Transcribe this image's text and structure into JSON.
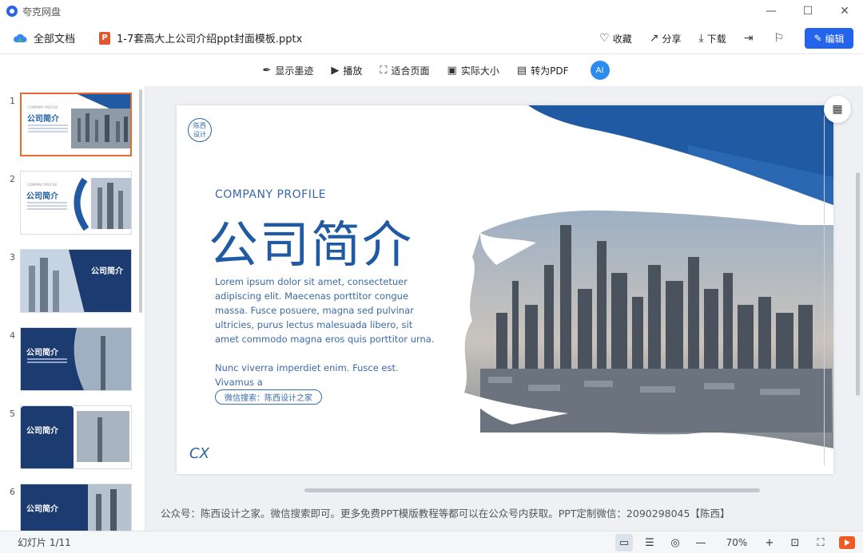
{
  "titlebar": {
    "app_name": "夸克网盘",
    "minimize": "—",
    "maximize": "☐",
    "close": "✕"
  },
  "docbar": {
    "all_docs": "全部文档",
    "file_icon": "P",
    "filename": "1-7套高大上公司介绍ppt封面模板.pptx",
    "favorite": "收藏",
    "share": "分享",
    "download": "下载",
    "edit": "编辑"
  },
  "toolbar": {
    "show_ink": "显示墨迹",
    "play": "播放",
    "fit_page": "适合页面",
    "actual_size": "实际大小",
    "to_pdf": "转为PDF",
    "ai": "AI"
  },
  "thumbnails": [
    {
      "num": "1",
      "sub": "COMPANY PROFILE",
      "title": "公司简介"
    },
    {
      "num": "2",
      "sub": "COMPANY PROFILE",
      "title": "公司简介"
    },
    {
      "num": "3",
      "sub": "COMPANY PROFILE",
      "title": "公司简介"
    },
    {
      "num": "4",
      "sub": "COMPANY PROFILE",
      "title": "公司简介"
    },
    {
      "num": "5",
      "sub": "COMPANY PROFILE",
      "title": "公司简介"
    },
    {
      "num": "6",
      "sub": "COMPANY PROFILE",
      "title": "公司简介"
    }
  ],
  "slide": {
    "logo_line1": "陈西",
    "logo_line2": "设计",
    "subtitle": "COMPANY PROFILE",
    "title": "公司简介",
    "body": "Lorem ipsum dolor sit amet, consectetuer adipiscing elit. Maecenas porttitor congue massa. Fusce posuere, magna sed pulvinar ultricies, purus lectus malesuada libero, sit amet commodo magna eros quis porttitor urna.",
    "body2": "Nunc viverra imperdiet enim. Fusce est. Vivamus a",
    "pill": "微信搜索：陈西设计之家",
    "cx": "CX"
  },
  "notes": "公众号：陈西设计之家。微信搜索即可。更多免费PPT模版教程等都可以在公众号内获取。PPT定制微信：2090298045【陈西】",
  "statusbar": {
    "slide_count": "幻灯片 1/11",
    "zoom": "70%"
  },
  "colors": {
    "accent": "#2463eb",
    "brand_blue": "#1f5aa3",
    "thumb_active": "#e8692e"
  }
}
